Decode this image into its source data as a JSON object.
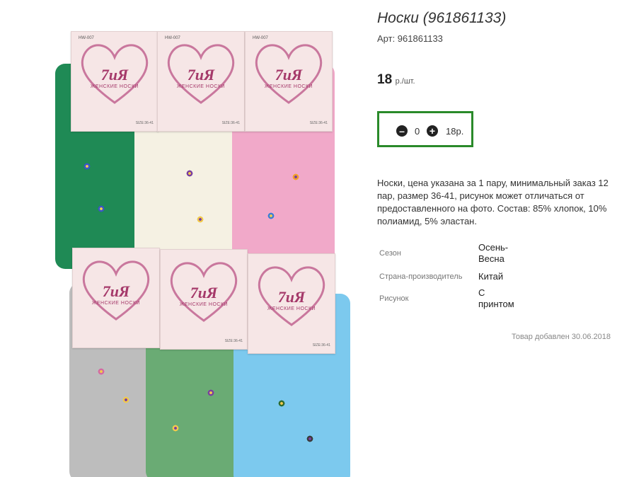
{
  "product": {
    "title": "Носки (961861133)",
    "article": "Арт: 961861133",
    "price": "18",
    "price_unit": "р./шт.",
    "quantity": "0",
    "sum": "18р.",
    "description": "Носки, цена указана за 1 пару, минимальный заказ 12 пар, размер 36-41, рисунок может отличаться от предоставленного на фото. Состав: 85% хлопок, 10% полиамид, 5% эластан.",
    "added": "Товар добавлен 30.06.2018"
  },
  "properties": [
    {
      "label": "Сезон",
      "value": "Осень-Весна"
    },
    {
      "label": "Страна-производитель",
      "value": "Китай"
    },
    {
      "label": "Рисунок",
      "value": "С принтом"
    }
  ],
  "photo": {
    "cards": [
      {
        "model": "HW-007",
        "brand": "7иЯ",
        "sub": "ЖЕНСКИЕ НОСКИ",
        "size": "SIZE:36-41"
      },
      {
        "model": "HW-007",
        "brand": "7иЯ",
        "sub": "ЖЕНСКИЕ НОСКИ",
        "size": "SIZE:36-41"
      },
      {
        "model": "HW-007",
        "brand": "7иЯ",
        "sub": "ЖЕНСКИЕ НОСКИ",
        "size": "SIZE:36-41"
      },
      {
        "model": "",
        "brand": "7иЯ",
        "sub": "ЖЕНСКИЕ НОСКИ",
        "size": ""
      },
      {
        "model": "",
        "brand": "7иЯ",
        "sub": "ЖЕНСКИЕ НОСКИ",
        "size": "SIZE:36-41"
      },
      {
        "model": "",
        "brand": "7иЯ",
        "sub": "ЖЕНСКИЕ НОСКИ",
        "size": "SIZE:36-41"
      }
    ],
    "sock_colors": [
      "#1f8a55",
      "#f5f1e3",
      "#f1a9c9",
      "#bdbdbd",
      "#6aab74",
      "#7cc9ee"
    ]
  },
  "icons": {
    "minus": "minus-circle-icon",
    "plus": "plus-circle-icon"
  },
  "colors": {
    "qty_border": "#2a8a2a",
    "brand": "#a5396a"
  }
}
